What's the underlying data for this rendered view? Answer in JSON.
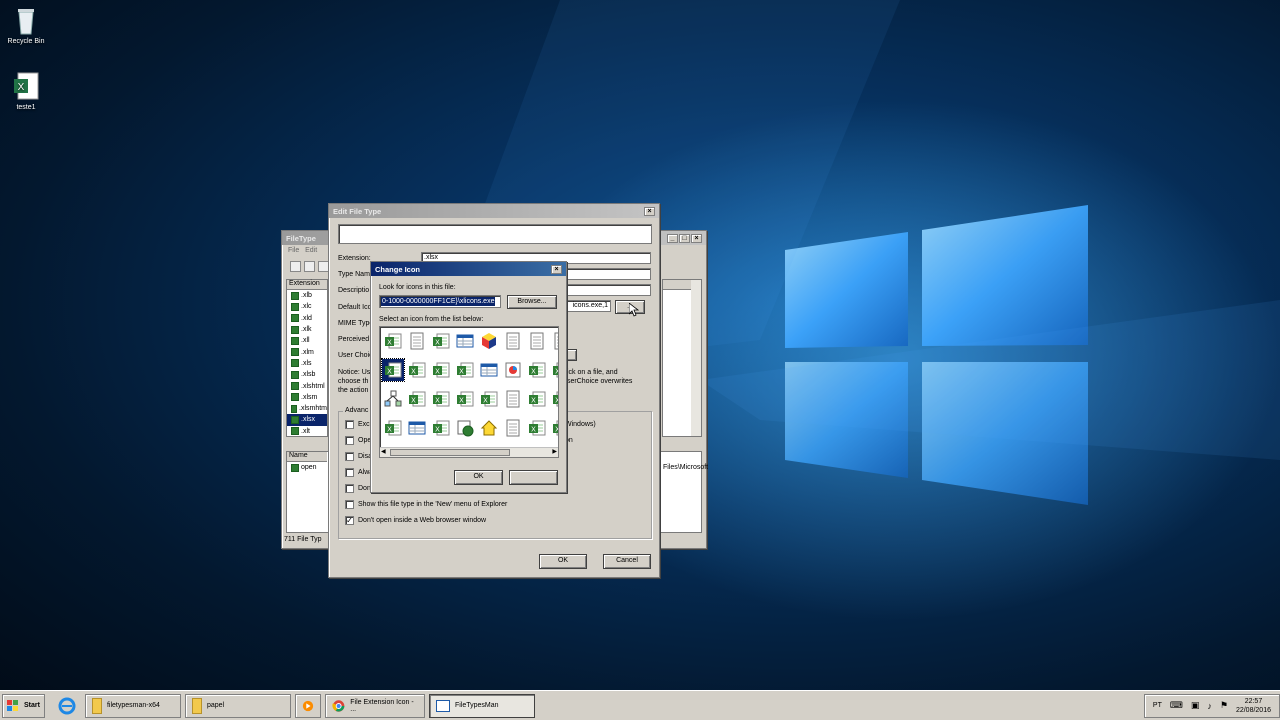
{
  "desktop": {
    "icons": [
      {
        "label": "Recycle Bin",
        "icon": "recycle-bin-icon"
      },
      {
        "label": "teste1",
        "icon": "excel-file-icon"
      }
    ]
  },
  "filetypes_window": {
    "title": "FileType",
    "menu": [
      "File",
      "Edit"
    ],
    "column_extension": "Extension",
    "extensions": [
      ".xlb",
      ".xlc",
      ".xld",
      ".xlk",
      ".xll",
      ".xlm",
      ".xls",
      ".xlsb",
      ".xlshtml",
      ".xlsm",
      ".xlsmhtm",
      ".xlsx",
      ".xlt"
    ],
    "selected_extension": ".xlsx",
    "actions_header": "Name",
    "actions": [
      "open"
    ],
    "right_path": "Files\\Microsoft",
    "status": "711 File Typ"
  },
  "edit_window": {
    "title": "Edit File Type",
    "labels": {
      "extension": "Extension:",
      "type_name": "Type Nam",
      "description": "Descriptio",
      "default_icon": "Default Ico",
      "mime_type": "MIME Type",
      "perceived": "Perceived",
      "user_choice": "User Choic",
      "notice_1": "Notice: Us",
      "notice_2": "choose th",
      "notice_3": "the action",
      "notice_right_1": "ick on a file, and",
      "notice_right_2": "serChoice overwrites",
      "advanced": "Advanc"
    },
    "values": {
      "extension": ".xlsx",
      "default_icon": "icons.exe,1"
    },
    "checkboxes": [
      {
        "label": "Excl",
        "right": "Windows)",
        "checked": false
      },
      {
        "label": "Ope",
        "right": "on",
        "checked": false
      },
      {
        "label": "Disa",
        "right": "",
        "checked": false
      },
      {
        "label": "Alwa",
        "right": "",
        "checked": false
      },
      {
        "label": "Don't add this file type to 'Recent Documents'",
        "right": "",
        "checked": false
      },
      {
        "label": "Show this file type in the 'New' menu of Explorer",
        "right": "",
        "checked": false
      },
      {
        "label": "Don't open inside a Web browser window",
        "right": "",
        "checked": true
      }
    ],
    "ok": "OK",
    "cancel": "Cancel",
    "browse_small": "..."
  },
  "change_icon_dialog": {
    "title": "Change Icon",
    "look_label": "Look for icons in this file:",
    "path_value": "0-1000-0000000FF1CE}\\xlicons.exe",
    "browse": "Browse...",
    "select_label": "Select an icon from the list below:",
    "ok": "OK",
    "cancel": ""
  },
  "taskbar": {
    "start": "Start",
    "tasks": [
      {
        "label": "filetypesman-x64",
        "icon": "folder-icon"
      },
      {
        "label": "papel",
        "icon": "folder-icon"
      },
      {
        "label": "",
        "icon": "media-player-icon"
      },
      {
        "label": "File Extension Icon - ...",
        "icon": "chrome-icon"
      },
      {
        "label": "FileTypesMan",
        "icon": "filetypesman-icon",
        "active": true
      }
    ],
    "lang": "PT",
    "time": "22:57",
    "date": "22/08/2016"
  },
  "colors": {
    "accent": "#0a246a",
    "excel_green": "#2e7d32",
    "wallpaper_blue": "#3fa8ff"
  }
}
